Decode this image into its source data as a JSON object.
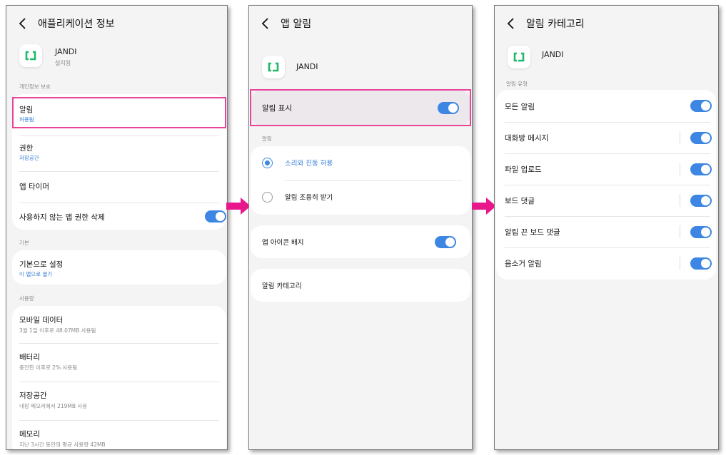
{
  "colors": {
    "accent": "#3d86e3",
    "highlight": "#e8459a",
    "arrow": "#e8188c",
    "brand_green": "#1fba6a"
  },
  "icons": {
    "back": "chevron-left-icon",
    "app": "jandi-logo-icon",
    "arrow": "right-arrow-icon"
  },
  "screen1": {
    "title": "애플리케이션 정보",
    "app_name": "JANDI",
    "app_status": "설치됨",
    "section_privacy": "개인정보 보호",
    "items_privacy": [
      {
        "label": "알림",
        "sub": "허용됨"
      },
      {
        "label": "권한",
        "sub": "저장공간"
      },
      {
        "label": "앱 타이머",
        "sub": ""
      },
      {
        "label": "사용하지 않는 앱 권한 삭제",
        "toggle_on": true
      }
    ],
    "section_default": "기본",
    "items_default": [
      {
        "label": "기본으로 설정",
        "sub": "이 앱으로 열기"
      }
    ],
    "section_usage": "사용량",
    "items_usage": [
      {
        "label": "모바일 데이터",
        "sub": "3월 1일 이후로 48.07MB 사용됨"
      },
      {
        "label": "배터리",
        "sub": "충전한 이후로 2% 사용됨"
      },
      {
        "label": "저장공간",
        "sub": "내장 메모리에서 219MB 사용"
      },
      {
        "label": "메모리",
        "sub": "지난 3시간 동안의 평균 사용량 42MB"
      }
    ]
  },
  "screen2": {
    "title": "앱 알림",
    "app_name": "JANDI",
    "show_notifications": {
      "label": "알림 표시",
      "toggle_on": true
    },
    "section_alerts": "알림",
    "radio_options": [
      {
        "label": "소리와 진동 허용",
        "selected": true
      },
      {
        "label": "알림 조용히 받기",
        "selected": false
      }
    ],
    "app_icon_badge": {
      "label": "앱 아이콘 배지",
      "toggle_on": true
    },
    "notification_categories": {
      "label": "알림 카테고리"
    }
  },
  "screen3": {
    "title": "알림 카테고리",
    "app_name": "JANDI",
    "section_types": "알림 유형",
    "categories": [
      {
        "label": "모든 알림",
        "toggle_on": true
      },
      {
        "label": "대화방 메시지",
        "toggle_on": true
      },
      {
        "label": "파일 업로드",
        "toggle_on": true
      },
      {
        "label": "보드 댓글",
        "toggle_on": true
      },
      {
        "label": "알림 끈 보드 댓글",
        "toggle_on": true
      },
      {
        "label": "음소거 알림",
        "toggle_on": true
      }
    ]
  }
}
